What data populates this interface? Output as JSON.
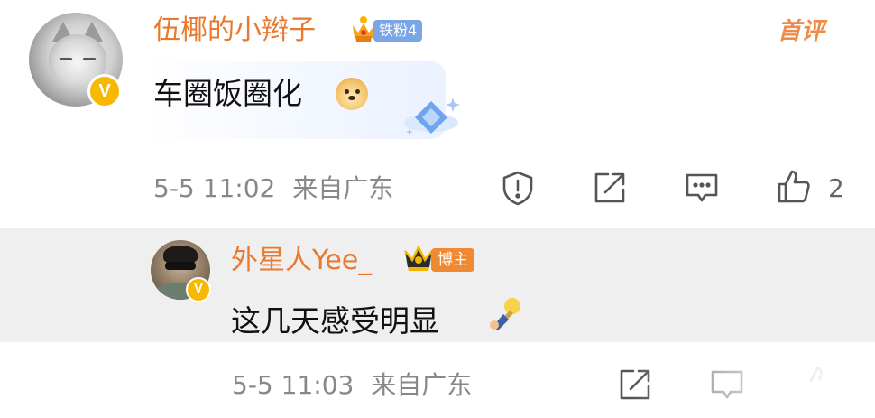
{
  "comment": {
    "username": "伍椰的小辫子",
    "fan_badge": "铁粉4",
    "top_tag": "首评",
    "text": "车圈饭圈化",
    "timestamp": "5-5 11:02",
    "location": "来自广东",
    "like_count": "2",
    "verified_mark": "V",
    "emoji": "doge-emoji",
    "decoration": "diamond-badge"
  },
  "reply": {
    "username": "外星人Yee_",
    "role_badge": "博主",
    "text": "这几天感受明显",
    "timestamp": "5-5 11:03",
    "location": "来自广东",
    "verified_mark": "V",
    "emoji": "holding-lightbulb-emoji"
  },
  "colors": {
    "username": "#e8792e",
    "meta_text": "#888888",
    "verified_badge": "#f8b700",
    "fan_badge_bg": "#7aa6e8",
    "bozhu_badge_bg": "#f08a32",
    "reply_bg": "#efefef"
  }
}
